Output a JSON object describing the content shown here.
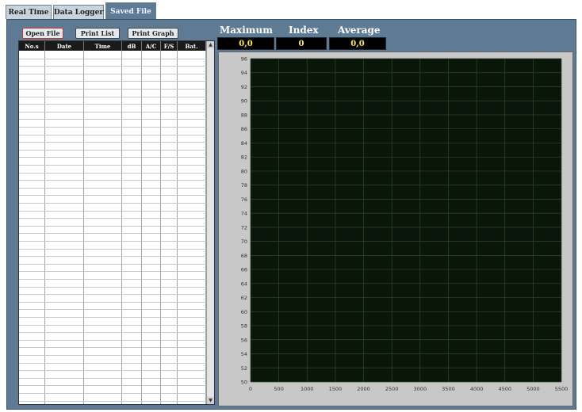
{
  "tabs": [
    {
      "label": "Real Time",
      "active": false
    },
    {
      "label": "Data Logger",
      "active": false
    },
    {
      "label": "Saved File",
      "active": true
    }
  ],
  "toolbar": {
    "open_file": "Open File",
    "print_list": "Print List",
    "print_graph": "Print Graph"
  },
  "stats": {
    "maximum": {
      "label": "Maximum",
      "value": "0,0"
    },
    "index": {
      "label": "Index",
      "value": "0"
    },
    "average": {
      "label": "Average",
      "value": "0,0"
    }
  },
  "table": {
    "columns": [
      "No.s",
      "Date",
      "Time",
      "dB",
      "A/C",
      "F/S",
      "Bat."
    ]
  },
  "colors": {
    "panel": "#5e7b96",
    "plot_bg": "#0b160b",
    "grid": "#2a4a2a",
    "stat_text": "#ffe94a"
  },
  "chart_data": {
    "type": "line",
    "x": [],
    "series": [],
    "xticks": [
      "0",
      "500",
      "1000",
      "1500",
      "2000",
      "2500",
      "3000",
      "3500",
      "4000",
      "4500",
      "5000",
      "5500"
    ],
    "yticks": [
      "50",
      "52",
      "54",
      "56",
      "58",
      "60",
      "62",
      "64",
      "66",
      "68",
      "70",
      "72",
      "74",
      "76",
      "78",
      "80",
      "82",
      "84",
      "86",
      "88",
      "90",
      "92",
      "94",
      "96"
    ],
    "xlim": [
      0,
      5500
    ],
    "ylim": [
      50,
      96
    ],
    "grid": true
  }
}
